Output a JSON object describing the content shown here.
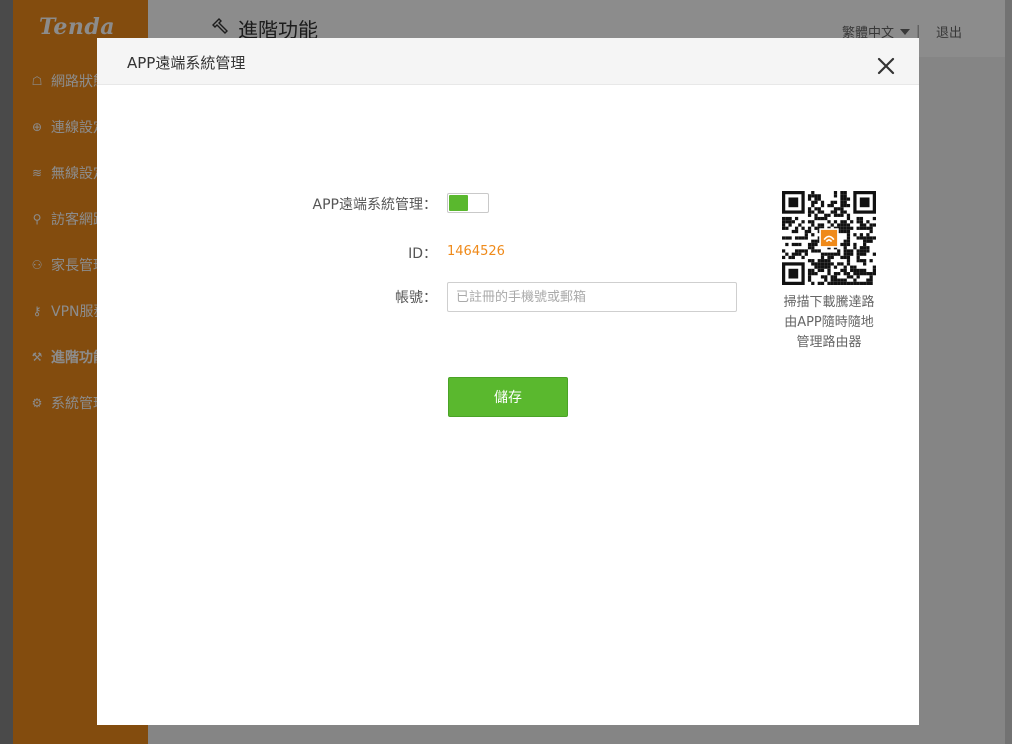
{
  "background": {
    "logo": "Tenda",
    "page_title": "進階功能",
    "language": "繁體中文",
    "separator": "|",
    "logout": "退出",
    "nav_items": [
      {
        "label": "網路狀態",
        "icon": "network-status-icon"
      },
      {
        "label": "連線設定",
        "icon": "globe-icon"
      },
      {
        "label": "無線設定",
        "icon": "wifi-icon"
      },
      {
        "label": "訪客網路",
        "icon": "guest-icon"
      },
      {
        "label": "家長管理",
        "icon": "family-icon"
      },
      {
        "label": "VPN服務",
        "icon": "vpn-icon"
      },
      {
        "label": "進階功能",
        "icon": "wrench-icon",
        "active": true
      },
      {
        "label": "系統管理",
        "icon": "gear-icon"
      }
    ]
  },
  "dialog": {
    "title": "APP遠端系統管理",
    "close_icon": "close-icon",
    "toggle_label": "APP遠端系統管理：",
    "toggle_on": true,
    "id_label": "ID：",
    "id_value": "1464526",
    "account_label": "帳號：",
    "account_value": "",
    "account_placeholder": "已註冊的手機號或郵箱",
    "save_label": "儲存",
    "qr_caption": [
      "掃描下載騰達路",
      "由APP隨時隨地",
      "管理路由器"
    ]
  },
  "colors": {
    "brand_orange": "#ef8a1a",
    "accent_green": "#5ab82e",
    "overlay": "rgba(0,0,0,0.45)"
  }
}
